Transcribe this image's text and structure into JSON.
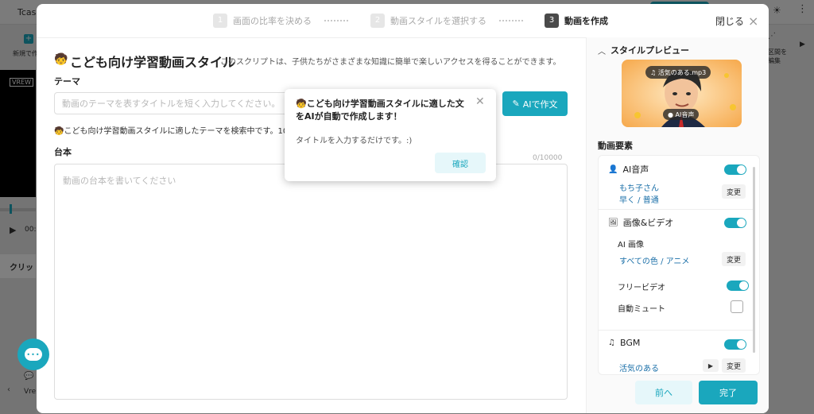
{
  "background": {
    "app_title": "Tcasa",
    "sun_icon": "sun-icon",
    "new_label": "新規で作",
    "video_logo": "VREW",
    "time": "00:",
    "clip_label": "クリッ",
    "vrew_label": "Vre",
    "right_label": "区間を\n編集"
  },
  "steps": [
    {
      "num": "1",
      "label": "画面の比率を決める"
    },
    {
      "num": "2",
      "label": "動画スタイルを選択する"
    },
    {
      "num": "3",
      "label": "動画を作成"
    }
  ],
  "header": {
    "close_label": "閉じる"
  },
  "style": {
    "title": "こども向け学習動画スタイル",
    "desc": "このスクリプトは、子供たちがさまざまな知識に簡単で楽しいアクセスを得ることができます。"
  },
  "theme": {
    "label": "テーマ",
    "placeholder": "動画のテーマを表すタイトルを短く入力してください。",
    "value": "",
    "ai_button": "AIで作文",
    "searching": "こども向け学習動画スタイルに適したテーマを検索中です。10"
  },
  "script": {
    "label": "台本",
    "counter": "0/10000",
    "placeholder": "動画の台本を書いてください",
    "value": ""
  },
  "popup": {
    "title": "こども向け学習動画スタイルに適した文をAIが自動で作成します！",
    "message": "タイトルを入力するだけです。:)",
    "confirm": "確認"
  },
  "preview": {
    "label": "スタイルプレビュー",
    "mp3": "活気のある.mp3",
    "ai_voice": "AI音声"
  },
  "elements": {
    "label": "動画要素",
    "voice": {
      "label": "AI音声",
      "on": true,
      "name": "もち子さん",
      "speed": "早く / 普通",
      "change": "変更"
    },
    "media": {
      "label": "画像&ビデオ",
      "on": true,
      "sub": "AI 画像",
      "style": "すべての色 / アニメ",
      "change": "変更",
      "free_video": "フリービデオ",
      "free_on": true,
      "auto_mute": "自動ミュート",
      "auto_mute_on": false
    },
    "bgm": {
      "label": "BGM",
      "on": true,
      "track": "活気のある",
      "change": "変更"
    }
  },
  "footer": {
    "prev": "前へ",
    "done": "完了"
  },
  "colors": {
    "accent": "#1aa7bd",
    "link": "#1a6fa8"
  }
}
